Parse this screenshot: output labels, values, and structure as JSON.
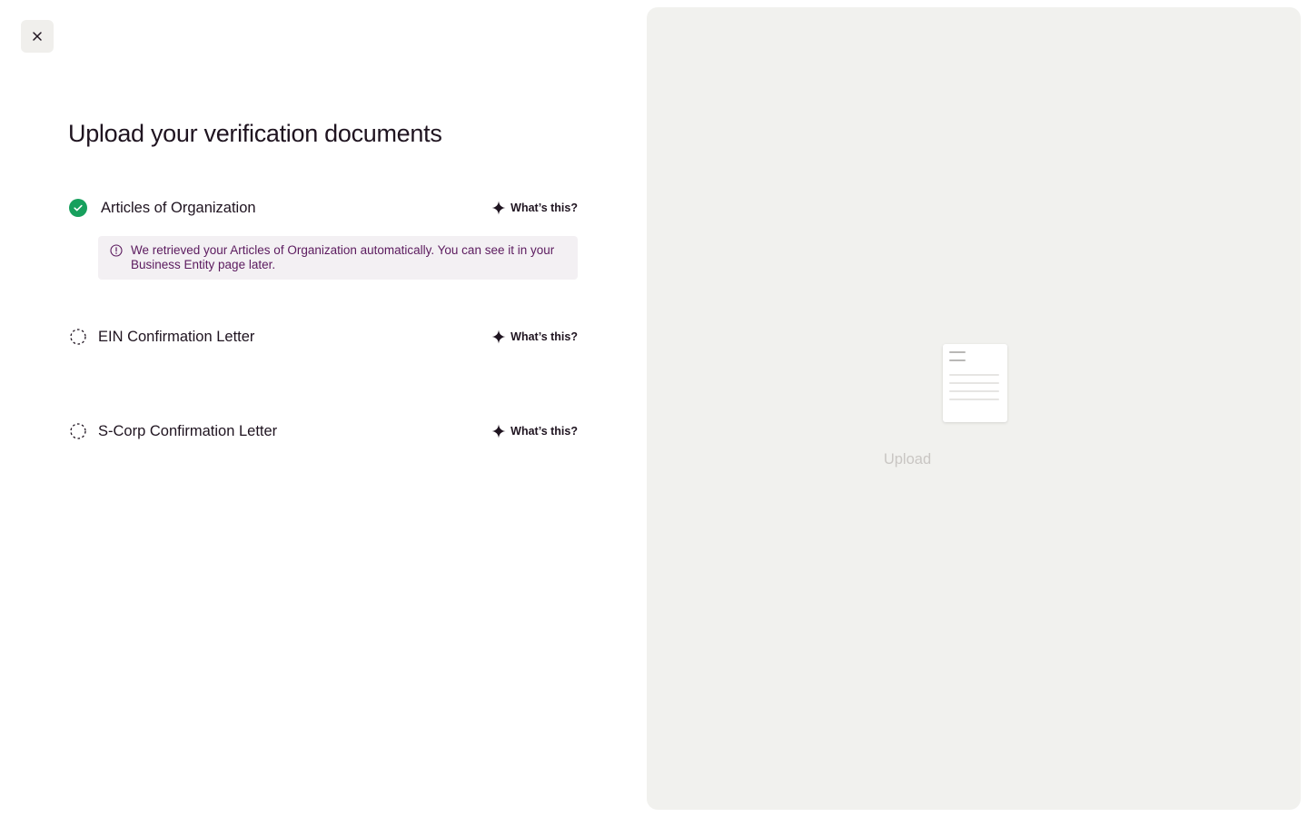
{
  "close_button": {
    "icon": "close-icon"
  },
  "title": "Upload your verification documents",
  "documents": [
    {
      "label": "Articles of Organization",
      "status": "complete",
      "help_label": "What’s this?"
    },
    {
      "label": "EIN Confirmation Letter",
      "status": "pending",
      "help_label": "What’s this?"
    },
    {
      "label": "S-Corp Confirmation Letter",
      "status": "pending",
      "help_label": "What’s this?"
    }
  ],
  "info_banner": {
    "text": "We retrieved your Articles of Organization automatically. You can see it in your Business Entity page later.",
    "icon": "info-icon"
  },
  "preview": {
    "upload_label": "Upload",
    "icon": "document-icon"
  },
  "colors": {
    "success": "#17a05d",
    "banner_bg": "#f3f0f3",
    "banner_text": "#5b1a5e",
    "panel_bg": "#f1f1ee"
  }
}
